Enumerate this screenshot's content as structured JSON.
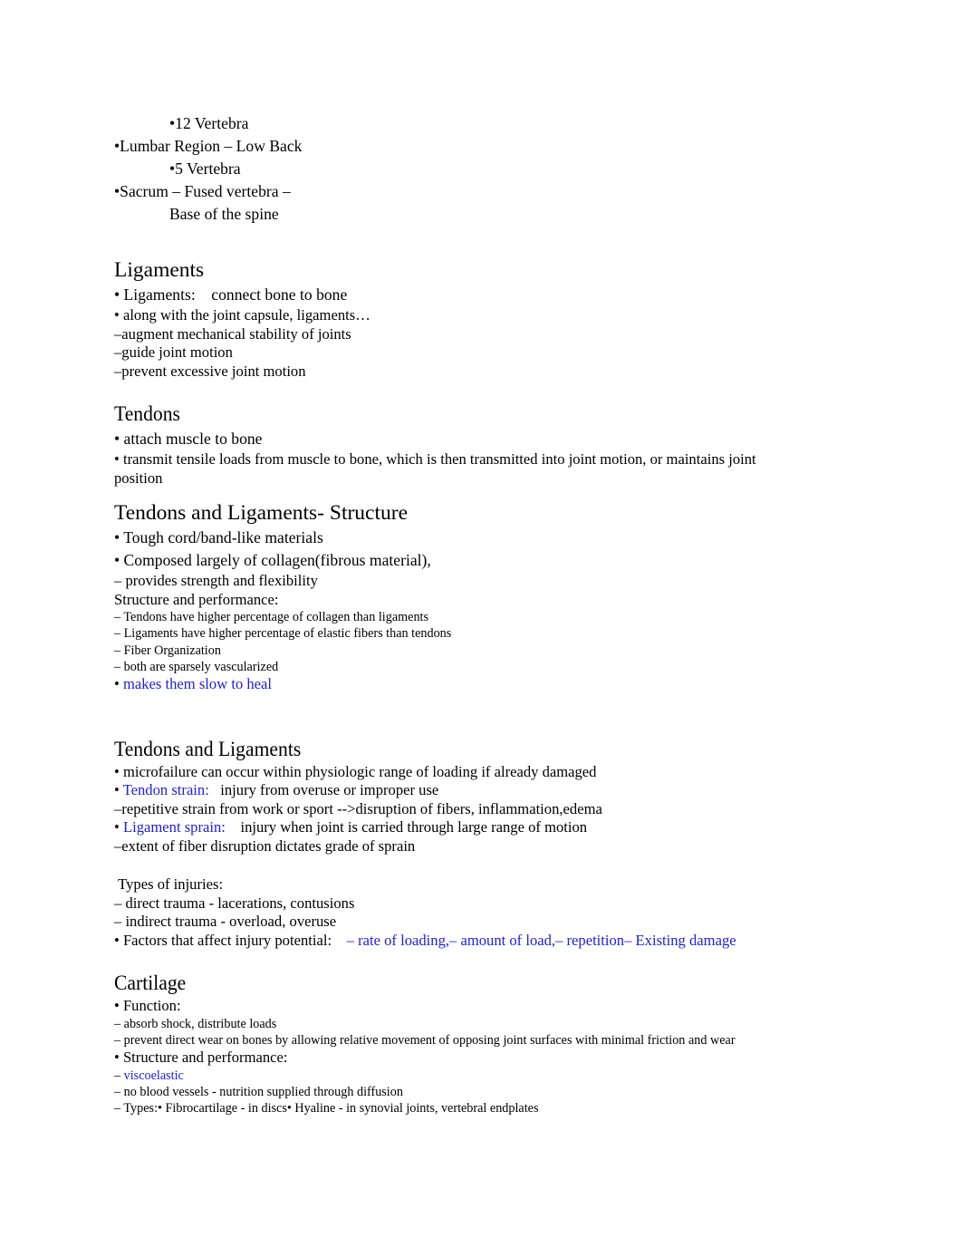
{
  "document": {
    "type": "lecture-notes",
    "colors": {
      "text": "#000000",
      "accent_blue": "#2020e0",
      "background": "#ffffff"
    }
  },
  "spine_section": {
    "lines": [
      {
        "text": "•12 Vertebra",
        "indent": true
      },
      {
        "text": "•Lumbar Region – Low Back",
        "indent": false
      },
      {
        "text": "•5 Vertebra",
        "indent": true
      },
      {
        "text": "•Sacrum – Fused vertebra –",
        "indent": false
      },
      {
        "text": "Base of the spine",
        "indent": true
      }
    ]
  },
  "ligaments": {
    "heading": "Ligaments",
    "lines": [
      "• Ligaments:    connect bone to bone",
      "• along with the joint capsule, ligaments…",
      "–augment mechanical stability of joints",
      "–guide joint motion",
      "–prevent excessive joint motion"
    ]
  },
  "tendons": {
    "heading": "Tendons",
    "lines": [
      "• attach muscle to bone",
      "• transmit tensile loads from muscle to bone, which is then transmitted into joint motion, or maintains joint position"
    ]
  },
  "tendons_ligaments_structure": {
    "heading": "Tendons and Ligaments- Structure",
    "line1": "• Tough cord/band-like materials",
    "line2": "• Composed largely of collagen(fibrous material),",
    "line3": "– provides strength and flexibility",
    "line4": "Structure and performance:",
    "sub_lines": [
      "– Tendons have higher percentage of collagen than ligaments",
      "– Ligaments have higher percentage of elastic fibers than tendons",
      "– Fiber Organization",
      "– both are sparsely vascularized"
    ],
    "blue_bullet_prefix": "• ",
    "blue_bullet_text": "makes them slow to heal"
  },
  "tendons_ligaments": {
    "heading": "Tendons and Ligaments",
    "line1": "• microfailure can occur within physiologic range of loading if already damaged",
    "line2_bullet": "• ",
    "line2_blue": "Tendon strain:",
    "line2_rest": "   injury from overuse or improper use",
    "line3": "–repetitive strain from work or sport -->disruption of fibers, inflammation,edema",
    "line4_bullet": "• ",
    "line4_blue": "Ligament sprain:",
    "line4_rest": "    injury when joint is carried through large range of motion",
    "line5": "–extent of fiber disruption dictates grade of sprain"
  },
  "injuries": {
    "line1": " Types of injuries:",
    "line2": "– direct trauma - lacerations, contusions",
    "line3": "– indirect trauma - overload, overuse",
    "line4_black": "• Factors that affect injury potential:",
    "line4_blue": "    – rate of loading,– amount of load,– repetition– Existing damage"
  },
  "cartilage": {
    "heading": "Cartilage",
    "line1": "• Function:",
    "line2": "– absorb shock, distribute loads",
    "line3": "– prevent direct wear on bones by allowing relative movement of opposing joint surfaces with minimal friction and wear",
    "line4": "• Structure and performance:",
    "line5_dash": "– ",
    "line5_blue": "viscoelastic",
    "line6": "– no blood vessels - nutrition supplied through diffusion",
    "line7": "– Types:• Fibrocartilage - in discs• Hyaline - in synovial joints, vertebral endplates"
  }
}
